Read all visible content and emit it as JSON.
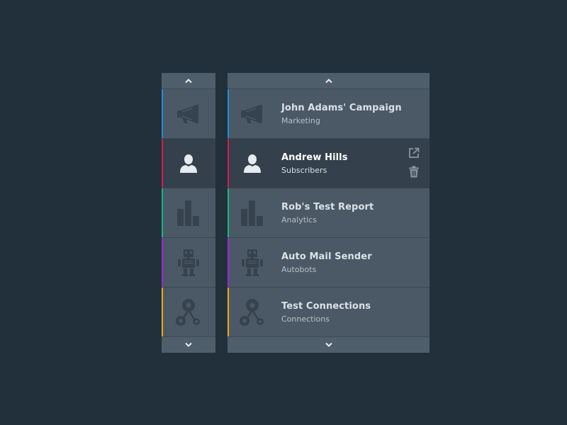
{
  "colors": {
    "background": "#22303c",
    "panel": "#4a5965",
    "active_row": "#34414c",
    "icon": "#36434e",
    "icon_active": "#e6ebef"
  },
  "nav": {
    "scroll_up_icon": "chevron-up-icon",
    "scroll_down_icon": "chevron-down-icon"
  },
  "items": [
    {
      "title": "John Adams' Campaign",
      "subtitle": "Marketing",
      "icon": "megaphone-icon",
      "accent": "#1e8fd8",
      "active": false
    },
    {
      "title": "Andrew Hills",
      "subtitle": "Subscribers",
      "icon": "user-icon",
      "accent": "#d81b4a",
      "active": true
    },
    {
      "title": "Rob's Test Report",
      "subtitle": "Analytics",
      "icon": "bar-chart-icon",
      "accent": "#17b583",
      "active": false
    },
    {
      "title": "Auto Mail Sender",
      "subtitle": "Autobots",
      "icon": "robot-icon",
      "accent": "#a325d6",
      "active": false
    },
    {
      "title": "Test Connections",
      "subtitle": "Connections",
      "icon": "connections-icon",
      "accent": "#f0a81c",
      "active": false
    }
  ],
  "actions": {
    "open_icon": "external-link-icon",
    "delete_icon": "trash-icon"
  }
}
